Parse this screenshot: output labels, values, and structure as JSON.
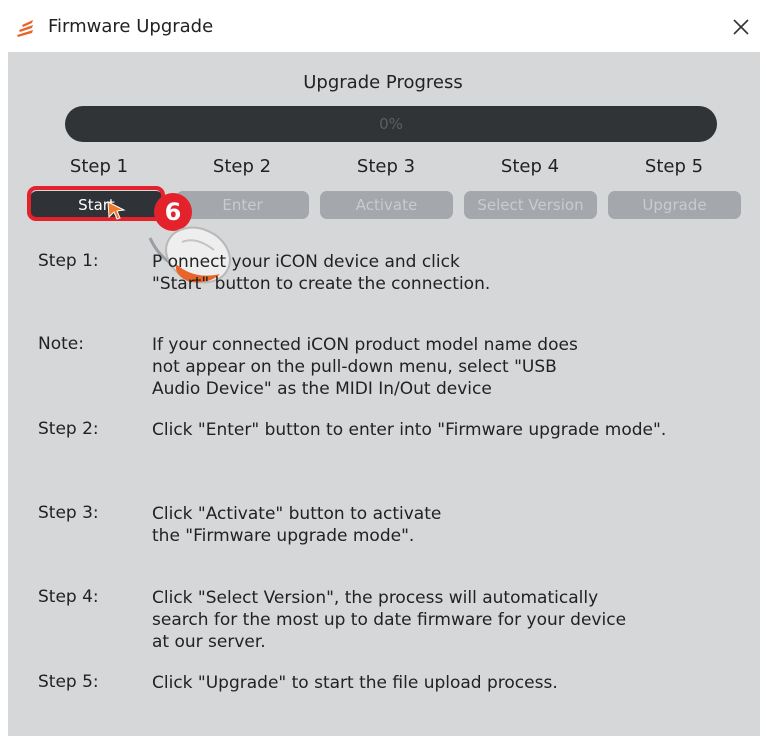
{
  "window": {
    "title": "Firmware Upgrade"
  },
  "progress": {
    "title": "Upgrade Progress",
    "percent_text": "0%",
    "value": 0
  },
  "steps": [
    {
      "label": "Step 1",
      "button": "Start",
      "active": true
    },
    {
      "label": "Step 2",
      "button": "Enter",
      "active": false
    },
    {
      "label": "Step 3",
      "button": "Activate",
      "active": false
    },
    {
      "label": "Step 4",
      "button": "Select Version",
      "active": false
    },
    {
      "label": "Step 5",
      "button": "Upgrade",
      "active": false
    }
  ],
  "annotation": {
    "badge_number": "6"
  },
  "instructions": [
    {
      "label": "Step 1:",
      "text": "P     onnect your iCON device and click\n\"Start\" button to create the connection."
    },
    {
      "label": "Note:",
      "text": "If your connected iCON product model name does\nnot appear on the pull-down menu, select \"USB\nAudio Device\" as the MIDI In/Out device"
    },
    {
      "label": "Step 2:",
      "text": "Click \"Enter\" button to enter into \"Firmware upgrade mode\"."
    },
    {
      "label": "Step 3:",
      "text": "Click \"Activate\" button to activate\nthe \"Firmware upgrade mode\"."
    },
    {
      "label": "Step 4:",
      "text": "Click \"Select Version\", the process will automatically\nsearch for the most up to date firmware for your device\nat our server."
    },
    {
      "label": "Step 5:",
      "text": "Click \"Upgrade\" to start the file upload process."
    }
  ],
  "colors": {
    "panel_bg": "#d6d7d9",
    "progress_track": "#313437",
    "button_disabled": "#a4a7ab",
    "button_active": "#2f3236",
    "highlight": "#e3222b",
    "app_icon": "#e8642a"
  },
  "icons": {
    "app": "flame-logo-icon",
    "close": "close-icon",
    "cursor": "mouse-pointer-icon"
  }
}
